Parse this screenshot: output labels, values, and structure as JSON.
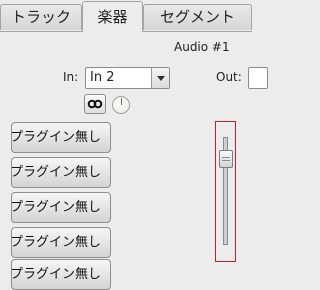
{
  "tabs": [
    {
      "label": "トラック",
      "active": false
    },
    {
      "label": "楽器",
      "active": true
    },
    {
      "label": "セグメント",
      "active": false
    }
  ],
  "instrument": {
    "name": "Audio #1",
    "in_label": "In:",
    "in_value": "In 2",
    "out_label": "Out:"
  },
  "plugins": [
    {
      "label": "プラグイン無し"
    },
    {
      "label": "プラグイン無し"
    },
    {
      "label": "プラグイン無し"
    },
    {
      "label": "プラグイン無し"
    },
    {
      "label": "プラグイン無し"
    }
  ],
  "colors": {
    "fader_highlight": "#c72222",
    "knob_indicator": "#4b8a3a"
  }
}
